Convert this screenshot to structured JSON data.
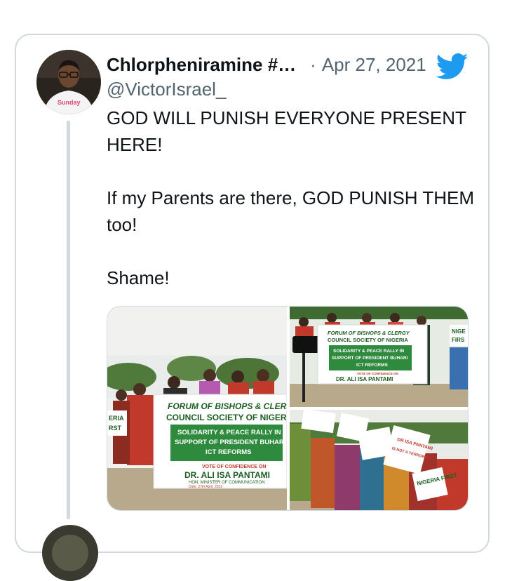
{
  "tweet": {
    "display_name": "Chlorpheniramine #…",
    "separator": "·",
    "date": "Apr 27, 2021",
    "handle": "@VictorIsrael_",
    "text_lines": [
      "GOD WILL PUNISH EVERYONE PRESENT HERE!",
      "",
      "If my Parents are there, GOD PUNISH THEM too!",
      "",
      "Shame!"
    ],
    "avatar_shirt_text": "Sunday",
    "platform_icon": "twitter-bird-icon",
    "accent_color": "#1d9bf0"
  },
  "media": {
    "photo_1": {
      "banner_line_1": "FORUM OF BISHOPS & CLERGY",
      "banner_line_2": "COUNCIL SOCIETY OF NIGERIA",
      "box_line_1": "SOLIDARITY & PEACE RALLY IN",
      "box_line_2": "SUPPORT OF PRESIDENT BUHARI",
      "box_line_3": "ICT REFORMS",
      "vote_line": "VOTE OF CONFIDENCE ON",
      "honoree": "DR. ALI ISA PANTAMI",
      "honoree_title": "HON. MINISTER OF COMMUNICATION",
      "date_line": "Date: 27th April, 2021",
      "left_sign_1": "ERIA",
      "left_sign_2": "RST"
    },
    "photo_2": {
      "banner_line_1": "FORUM OF BISHOPS & CLERGY",
      "banner_line_2": "COUNCIL SOCIETY OF NIGERIA",
      "box_line_1": "SOLIDARITY & PEACE RALLY IN",
      "box_line_2": "SUPPORT OF PRESIDENT BUHARI",
      "box_line_3": "ICT REFORMS",
      "vote_line": "VOTE OF CONFIDENCE ON",
      "honoree": "DR. ALI ISA PANTAMI",
      "side_sign_1": "NIGE",
      "side_sign_2": "FIRS"
    },
    "photo_3": {
      "sign_1": "DR ISA PANTAMI",
      "sign_2": "IS NOT A TERRORIST",
      "sign_3": "NIGERIA FIRST"
    }
  }
}
